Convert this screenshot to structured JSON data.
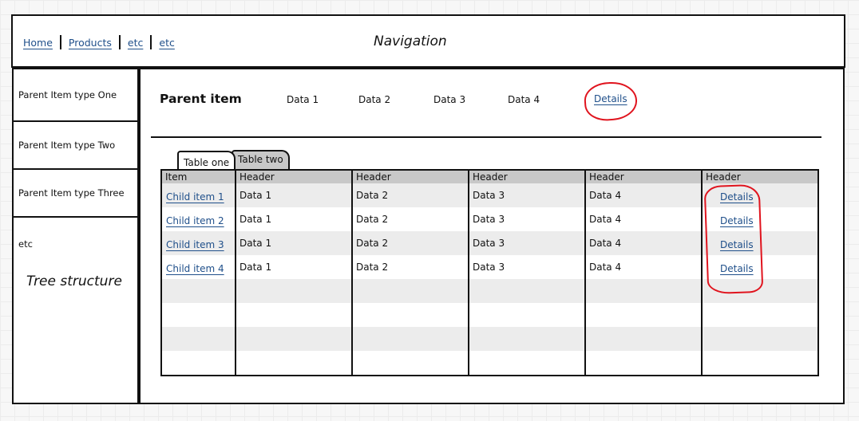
{
  "navigation": {
    "links": [
      "Home",
      "Products",
      "etc",
      "etc"
    ],
    "title": "Navigation"
  },
  "sidebar": {
    "items": [
      "Parent Item type One",
      "Parent Item type Two",
      "Parent Item type Three",
      "etc"
    ],
    "label": "Tree structure"
  },
  "parent": {
    "title": "Parent item",
    "data": [
      "Data 1",
      "Data 2",
      "Data 3",
      "Data 4"
    ],
    "details_link": "Details"
  },
  "tabs": [
    "Table one",
    "Table two"
  ],
  "table": {
    "headers": [
      "Item",
      "Header",
      "Header",
      "Header",
      "Header",
      "Header"
    ],
    "rows": [
      [
        "Child item 1",
        "Data 1",
        "Data 2",
        "Data 3",
        "Data 4",
        "Details"
      ],
      [
        "Child item 2",
        "Data 1",
        "Data 2",
        "Data 3",
        "Data 4",
        "Details"
      ],
      [
        "Child item 3",
        "Data 1",
        "Data 2",
        "Data 3",
        "Data 4",
        "Details"
      ],
      [
        "Child item 4",
        "Data 1",
        "Data 2",
        "Data 3",
        "Data 4",
        "Details"
      ]
    ],
    "empty_rows": 4
  },
  "colors": {
    "link": "#1f4f8a",
    "annotation": "#e0141e",
    "header_bg": "#c8c8c8",
    "stripe_bg": "#ececec"
  }
}
